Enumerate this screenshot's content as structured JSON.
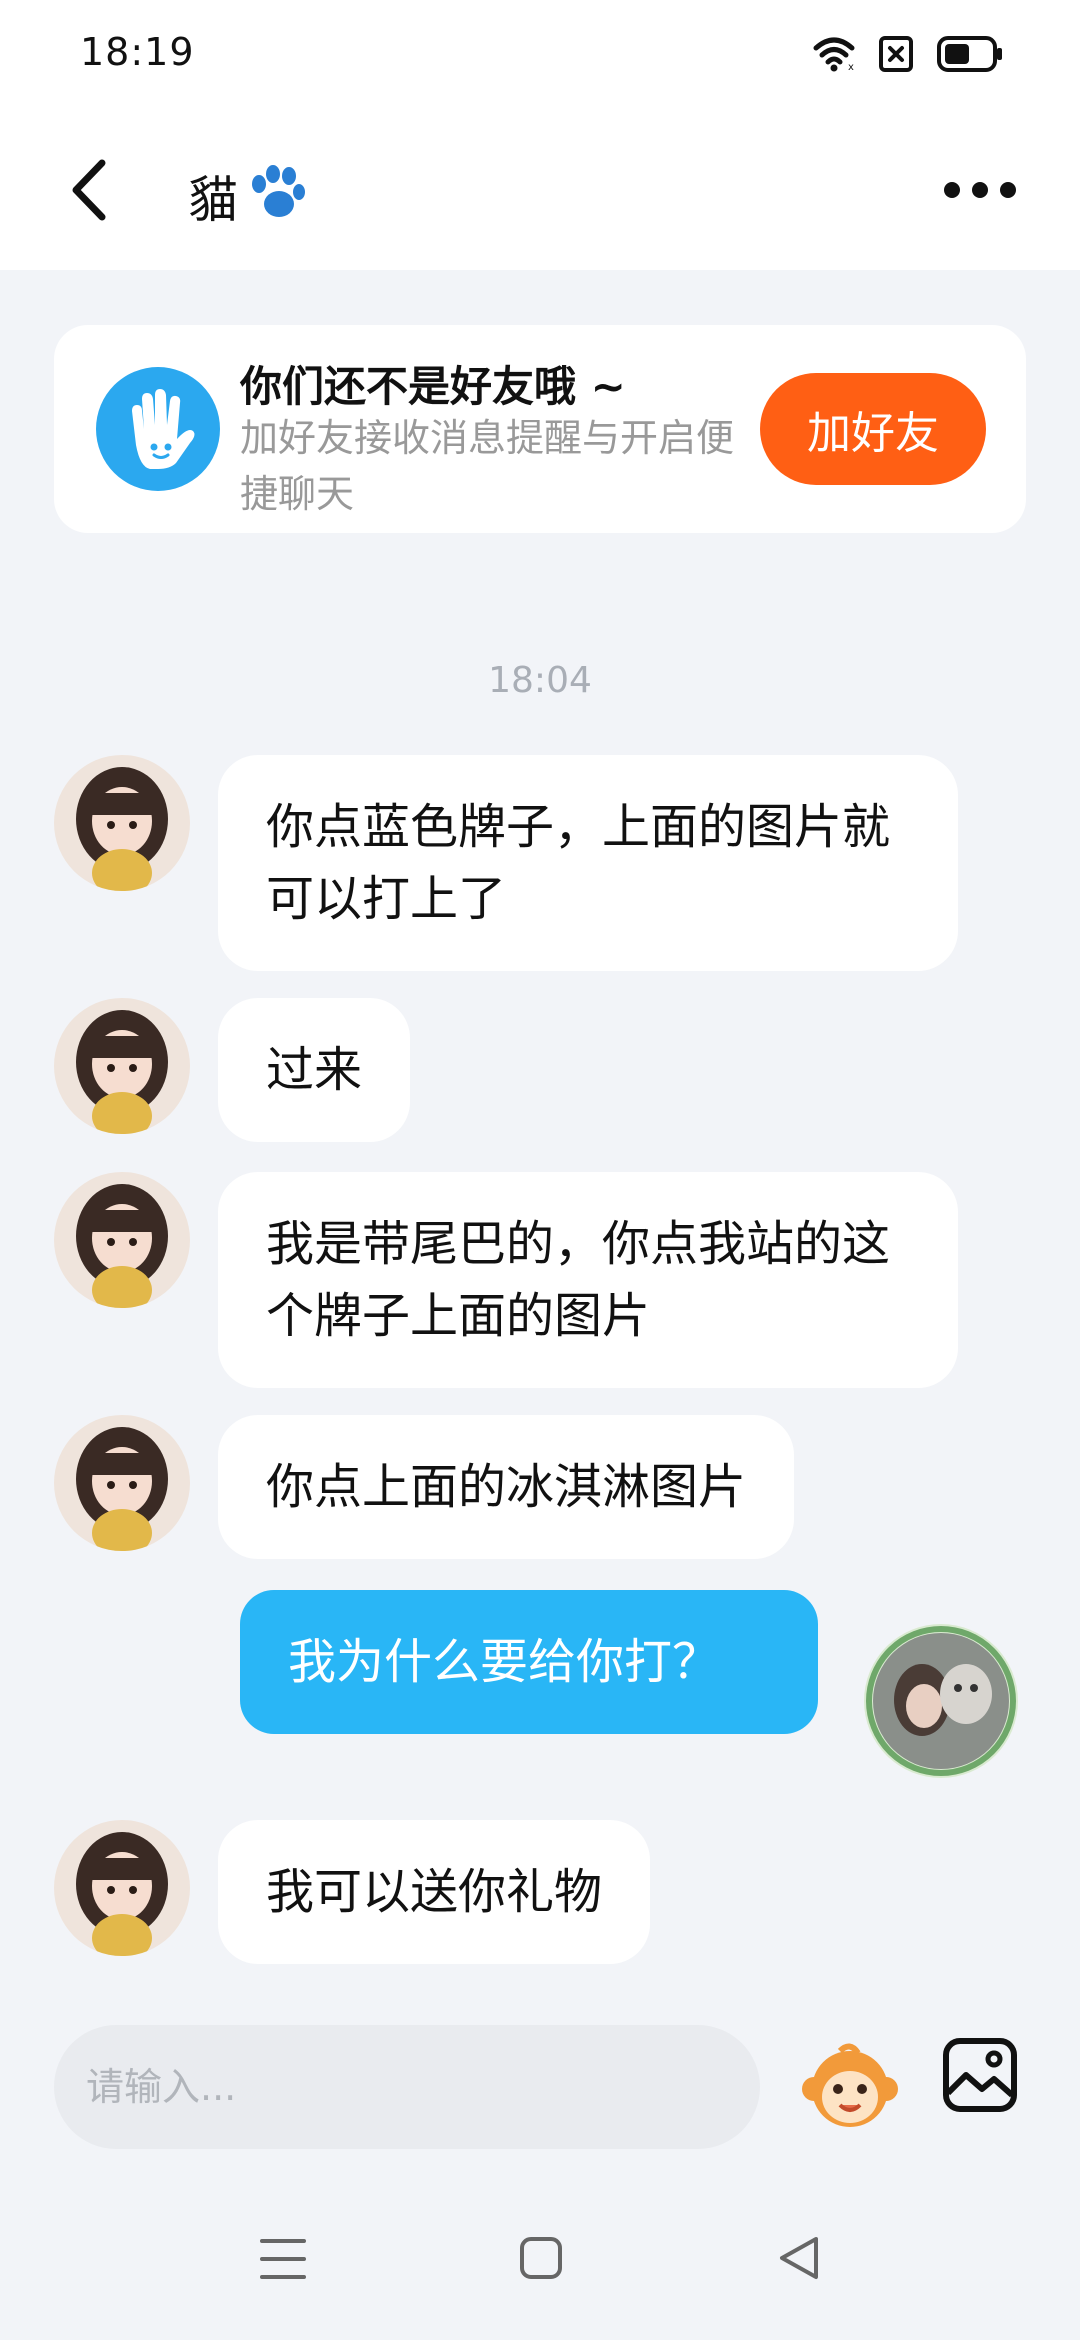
{
  "status_bar": {
    "time": "18:19"
  },
  "header": {
    "title": "貓"
  },
  "banner": {
    "title": "你们还不是好友哦 ~",
    "subtitle": "加好友接收消息提醒与开启便捷聊天",
    "button_label": "加好友"
  },
  "timestamp": "18:04",
  "messages": [
    {
      "side": "left",
      "text": "你点蓝色牌子，上面的图片就可以打上了"
    },
    {
      "side": "left",
      "text": "过来"
    },
    {
      "side": "left",
      "text": "我是带尾巴的，你点我站的这个牌子上面的图片"
    },
    {
      "side": "left",
      "text": "你点上面的冰淇淋图片"
    },
    {
      "side": "right",
      "text": "我为什么要给你打？"
    },
    {
      "side": "left",
      "text": "我可以送你礼物"
    }
  ],
  "input": {
    "placeholder": "请输入..."
  },
  "colors": {
    "accent_blue": "#29b6f6",
    "add_friend_orange": "#ff5f14",
    "background": "#f2f4f8"
  },
  "icons": [
    "back-arrow-icon",
    "paw-icon",
    "more-icon",
    "wave-hand-icon",
    "sticker-monkey-icon",
    "image-icon",
    "wifi-icon",
    "sim-icon",
    "battery-icon"
  ]
}
